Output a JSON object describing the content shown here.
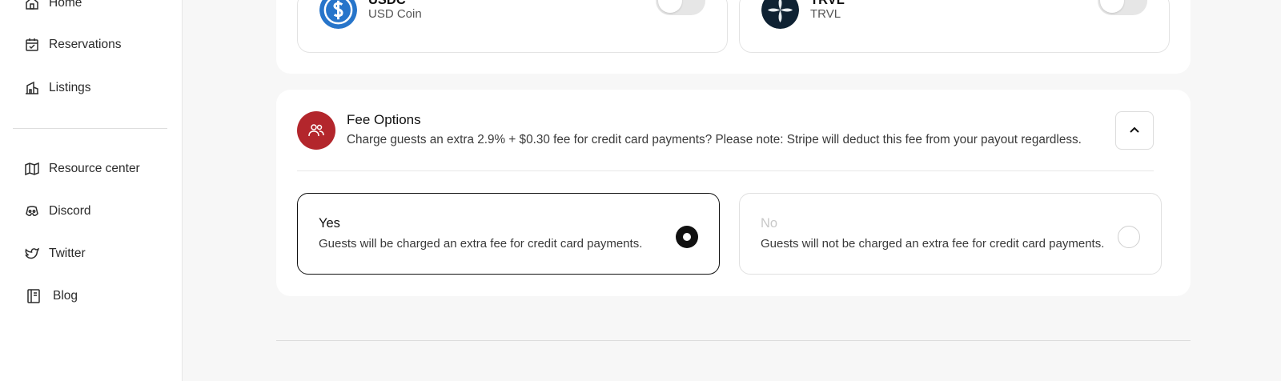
{
  "sidebar": {
    "items": [
      {
        "label": "Home",
        "icon": "home-icon"
      },
      {
        "label": "Reservations",
        "icon": "calendar-check-icon"
      },
      {
        "label": "Listings",
        "icon": "building-icon"
      },
      {
        "label": "Resource center",
        "icon": "map-icon"
      },
      {
        "label": "Discord",
        "icon": "discord-icon"
      },
      {
        "label": "Twitter",
        "icon": "twitter-icon"
      },
      {
        "label": "Blog",
        "icon": "book-icon"
      }
    ]
  },
  "crypto": [
    {
      "name": "USDC",
      "subtitle": "USD Coin",
      "enabled": false,
      "logo_color": "#2775ca"
    },
    {
      "name": "TRVL",
      "subtitle": "TRVL",
      "enabled": false,
      "logo_color": "#0f2233"
    }
  ],
  "fee_options": {
    "title": "Fee Options",
    "description": "Charge guests an extra 2.9% + $0.30 fee for credit card payments? Please note: Stripe will deduct this fee from your payout regardless.",
    "icon_color": "#b3262c",
    "options": [
      {
        "title": "Yes",
        "description": "Guests will be charged an extra fee for credit card payments.",
        "selected": true
      },
      {
        "title": "No",
        "description": "Guests will not be charged an extra fee for credit card payments.",
        "selected": false
      }
    ]
  }
}
